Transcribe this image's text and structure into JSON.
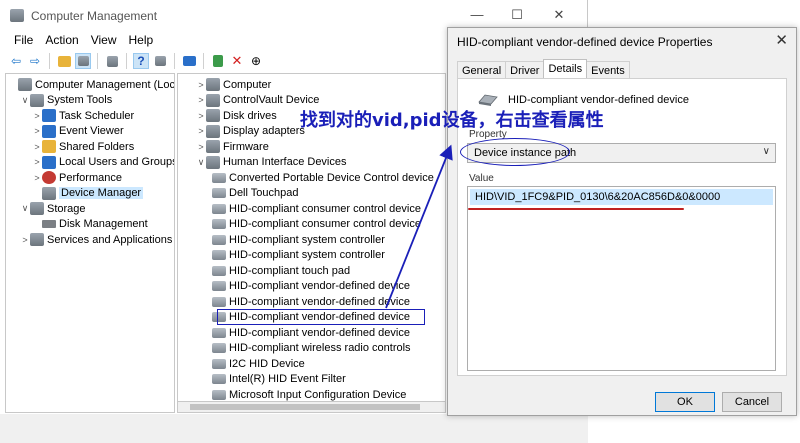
{
  "window": {
    "title": "Computer Management",
    "minimize": "—",
    "maximize": "☐",
    "close": "✕"
  },
  "menu": [
    "File",
    "Action",
    "View",
    "Help"
  ],
  "left_tree": [
    {
      "label": "Computer Management (Local)",
      "indent": 0,
      "exp": "",
      "icon": "computer-management-icon"
    },
    {
      "label": "System Tools",
      "indent": 1,
      "exp": "∨",
      "icon": "tools-icon"
    },
    {
      "label": "Task Scheduler",
      "indent": 2,
      "exp": ">",
      "icon": "clock-icon"
    },
    {
      "label": "Event Viewer",
      "indent": 2,
      "exp": ">",
      "icon": "event-viewer-icon"
    },
    {
      "label": "Shared Folders",
      "indent": 2,
      "exp": ">",
      "icon": "shared-folder-icon"
    },
    {
      "label": "Local Users and Groups",
      "indent": 2,
      "exp": ">",
      "icon": "users-icon"
    },
    {
      "label": "Performance",
      "indent": 2,
      "exp": ">",
      "icon": "performance-icon"
    },
    {
      "label": "Device Manager",
      "indent": 2,
      "exp": "",
      "icon": "device-manager-icon",
      "selected": true
    },
    {
      "label": "Storage",
      "indent": 1,
      "exp": "∨",
      "icon": "storage-icon"
    },
    {
      "label": "Disk Management",
      "indent": 2,
      "exp": "",
      "icon": "disk-icon"
    },
    {
      "label": "Services and Applications",
      "indent": 1,
      "exp": ">",
      "icon": "services-icon"
    }
  ],
  "device_tree": [
    {
      "label": "Computer",
      "indent": 0,
      "exp": ">"
    },
    {
      "label": "ControlVault Device",
      "indent": 0,
      "exp": ">"
    },
    {
      "label": "Disk drives",
      "indent": 0,
      "exp": ">"
    },
    {
      "label": "Display adapters",
      "indent": 0,
      "exp": ">"
    },
    {
      "label": "Firmware",
      "indent": 0,
      "exp": ">"
    },
    {
      "label": "Human Interface Devices",
      "indent": 0,
      "exp": "∨"
    },
    {
      "label": "Converted Portable Device Control device",
      "indent": 1,
      "exp": ""
    },
    {
      "label": "Dell Touchpad",
      "indent": 1,
      "exp": ""
    },
    {
      "label": "HID-compliant consumer control device",
      "indent": 1,
      "exp": ""
    },
    {
      "label": "HID-compliant consumer control device",
      "indent": 1,
      "exp": ""
    },
    {
      "label": "HID-compliant system controller",
      "indent": 1,
      "exp": ""
    },
    {
      "label": "HID-compliant system controller",
      "indent": 1,
      "exp": ""
    },
    {
      "label": "HID-compliant touch pad",
      "indent": 1,
      "exp": ""
    },
    {
      "label": "HID-compliant vendor-defined device",
      "indent": 1,
      "exp": ""
    },
    {
      "label": "HID-compliant vendor-defined device",
      "indent": 1,
      "exp": ""
    },
    {
      "label": "HID-compliant vendor-defined device",
      "indent": 1,
      "exp": "",
      "highlighted": true
    },
    {
      "label": "HID-compliant vendor-defined device",
      "indent": 1,
      "exp": ""
    },
    {
      "label": "HID-compliant wireless radio controls",
      "indent": 1,
      "exp": ""
    },
    {
      "label": "I2C HID Device",
      "indent": 1,
      "exp": ""
    },
    {
      "label": "Intel(R) HID Event Filter",
      "indent": 1,
      "exp": ""
    },
    {
      "label": "Microsoft Input Configuration Device",
      "indent": 1,
      "exp": ""
    }
  ],
  "dialog": {
    "title": "HID-compliant vendor-defined device Properties",
    "close": "✕",
    "tabs": [
      "General",
      "Driver",
      "Details",
      "Events"
    ],
    "active_tab": "Details",
    "device_name": "HID-compliant vendor-defined device",
    "property_label": "Property",
    "property_value": "Device instance path",
    "value_label": "Value",
    "value": "HID\\VID_1FC9&PID_0130\\6&20AC856D&0&0000",
    "ok": "OK",
    "cancel": "Cancel"
  },
  "annotation": "找到对的vid,pid设备，右击查看属性",
  "colors": {
    "annotation": "#1a1fb8",
    "underline": "#c02020",
    "selection": "#cce8ff"
  }
}
